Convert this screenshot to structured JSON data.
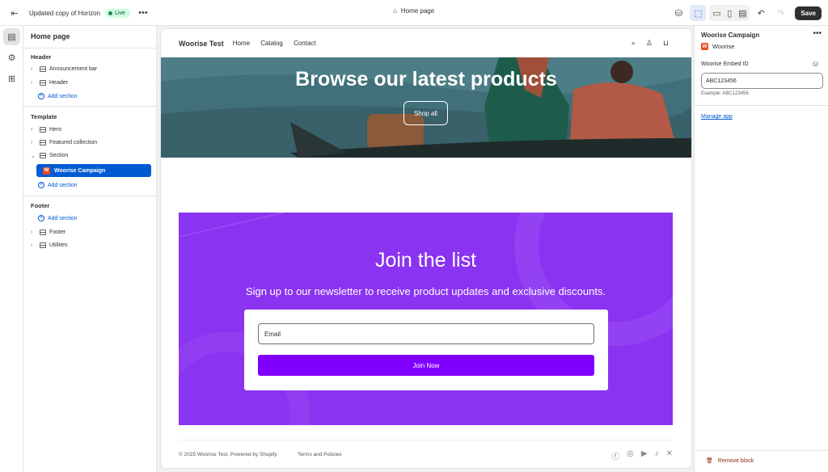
{
  "topbar": {
    "title": "Updated copy of Horizon",
    "status": "Live",
    "page": "Home page",
    "save": "Save"
  },
  "left": {
    "title": "Home page",
    "header_group": "Header",
    "header_items": [
      "Announcement bar",
      "Header"
    ],
    "add_section": "Add section",
    "template_group": "Template",
    "template_items": [
      "Hero",
      "Featured collection",
      "Section"
    ],
    "selected_block": "Woorise Campaign",
    "footer_group": "Footer",
    "footer_items": [
      "Footer",
      "Utilities"
    ]
  },
  "store": {
    "brand": "Woorise Test",
    "nav": [
      "Home",
      "Catalog",
      "Contact"
    ],
    "hero_title": "Browse our latest products",
    "hero_button": "Shop all",
    "signup_title": "Join the list",
    "signup_text": "Sign up to our newsletter to receive product updates and exclusive discounts.",
    "email_placeholder": "Email",
    "join_button": "Join Now",
    "copyright": "© 2025 Woorise Test, Powered by Shopify",
    "policies": "Terms and Policies"
  },
  "right": {
    "title": "Woorise Campaign",
    "app": "Woorise",
    "label": "Woorise Embed ID",
    "value": "ABC123456",
    "help": "Example: ABC123456",
    "manage": "Manage app",
    "remove": "Remove block"
  },
  "colors": {
    "accent": "#005bd3",
    "signup_bg": "#8a33f0",
    "join_button": "#8000ff",
    "hero_bg": "#3f6a73"
  }
}
